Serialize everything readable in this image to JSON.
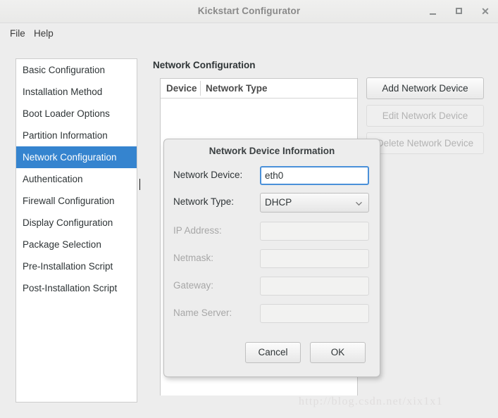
{
  "window": {
    "title": "Kickstart Configurator",
    "controls": {
      "minimize": "minimize-icon",
      "maximize": "maximize-icon",
      "close": "close-icon"
    }
  },
  "menubar": {
    "items": [
      {
        "label": "File"
      },
      {
        "label": "Help"
      }
    ]
  },
  "sidebar": {
    "items": [
      {
        "label": "Basic Configuration",
        "selected": false
      },
      {
        "label": "Installation Method",
        "selected": false
      },
      {
        "label": "Boot Loader Options",
        "selected": false
      },
      {
        "label": "Partition Information",
        "selected": false
      },
      {
        "label": "Network Configuration",
        "selected": true
      },
      {
        "label": "Authentication",
        "selected": false
      },
      {
        "label": "Firewall Configuration",
        "selected": false
      },
      {
        "label": "Display Configuration",
        "selected": false
      },
      {
        "label": "Package Selection",
        "selected": false
      },
      {
        "label": "Pre-Installation Script",
        "selected": false
      },
      {
        "label": "Post-Installation Script",
        "selected": false
      }
    ],
    "selected_color": "#3584cf"
  },
  "main": {
    "heading": "Network Configuration",
    "table": {
      "columns": [
        "Device",
        "Network Type"
      ],
      "rows": []
    },
    "buttons": [
      {
        "label": "Add Network Device",
        "enabled": true
      },
      {
        "label": "Edit Network Device",
        "enabled": false
      },
      {
        "label": "Delete Network Device",
        "enabled": false
      }
    ]
  },
  "dialog": {
    "title": "Network Device Information",
    "fields": [
      {
        "label": "Network Device:",
        "value": "eth0",
        "enabled": true,
        "focused": true
      },
      {
        "label": "Network Type:",
        "value": "DHCP",
        "enabled": true,
        "type": "select"
      },
      {
        "label": "IP Address:",
        "value": "",
        "enabled": false
      },
      {
        "label": "Netmask:",
        "value": "",
        "enabled": false
      },
      {
        "label": "Gateway:",
        "value": "",
        "enabled": false
      },
      {
        "label": "Name Server:",
        "value": "",
        "enabled": false
      }
    ],
    "buttons": {
      "cancel": "Cancel",
      "ok": "OK"
    }
  },
  "watermark": "http://blog.csdn.net/xix1x1"
}
